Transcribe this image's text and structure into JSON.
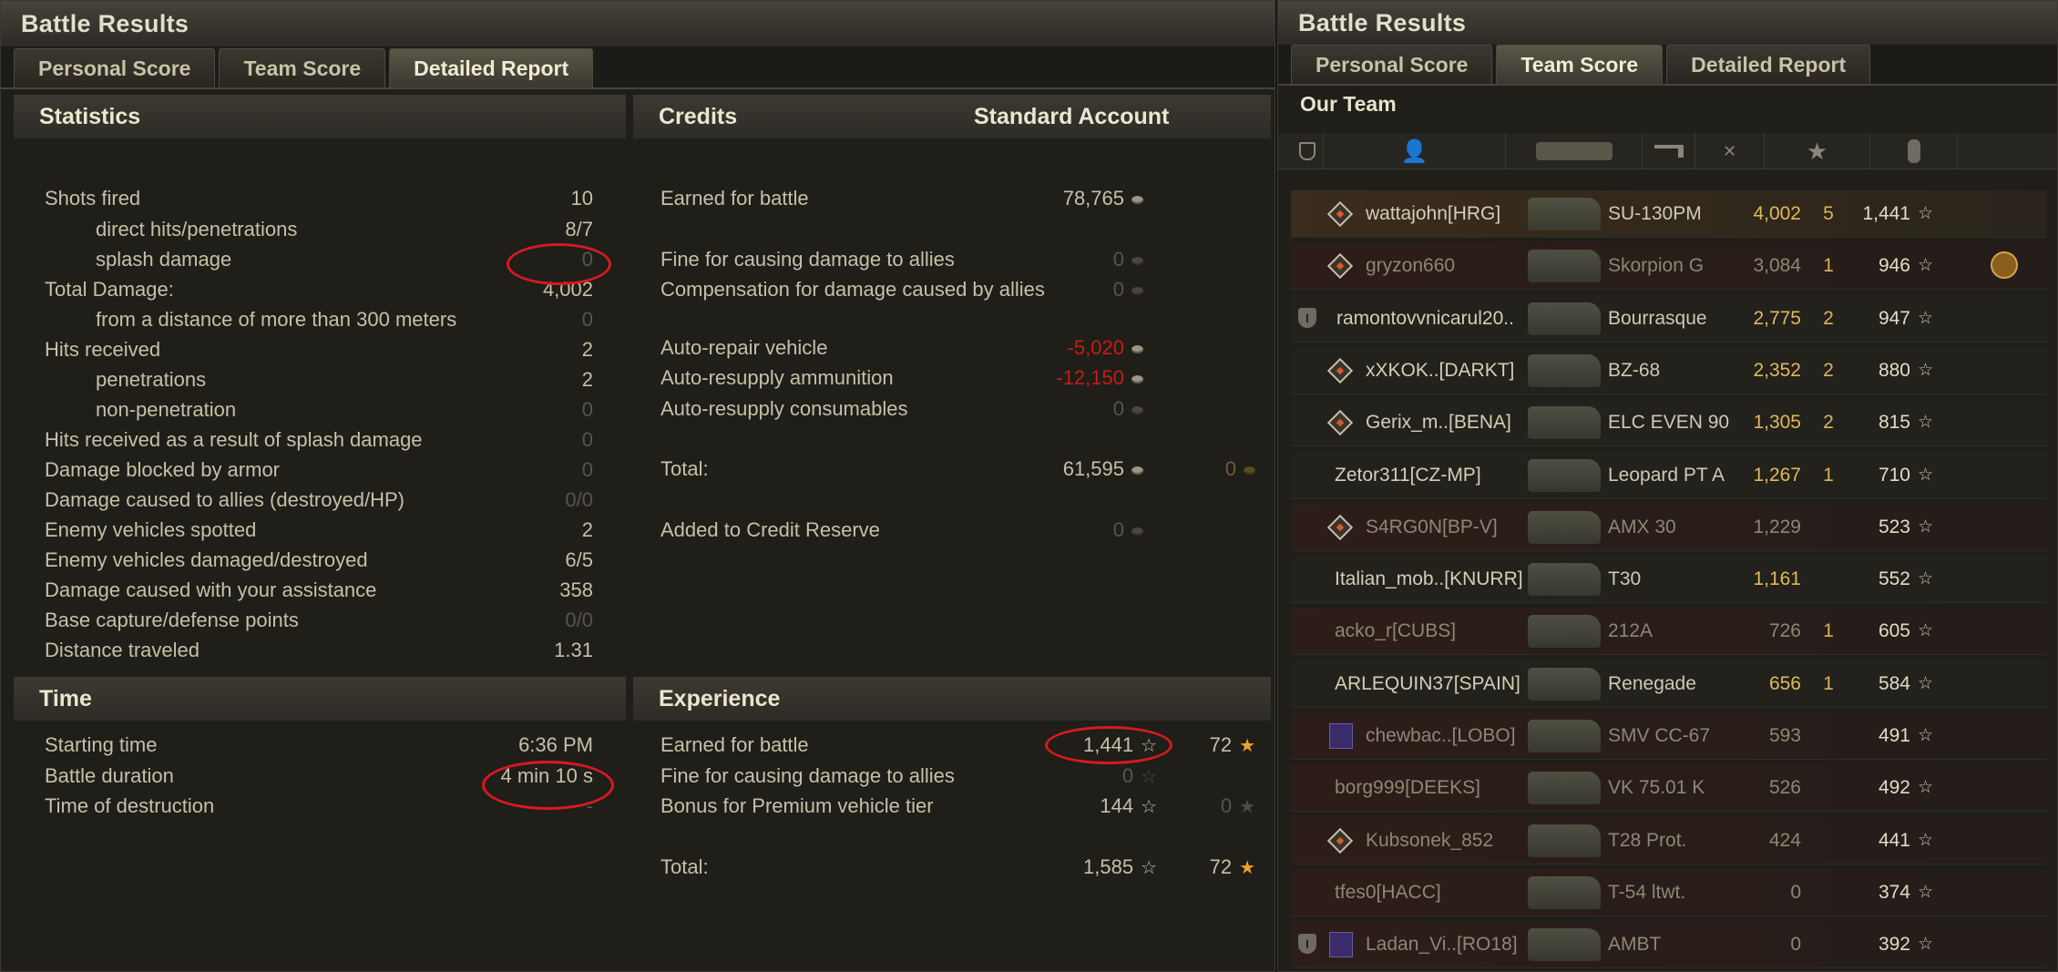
{
  "left_window": {
    "title": "Battle Results",
    "tabs": [
      "Personal Score",
      "Team Score",
      "Detailed Report"
    ],
    "active_tab": 2,
    "statistics": {
      "header": "Statistics",
      "rows": [
        {
          "label": "Shots fired",
          "value": "10",
          "indent": false,
          "dim": false
        },
        {
          "label": "direct hits/penetrations",
          "value": "8/7",
          "indent": true,
          "dim": false
        },
        {
          "label": "splash damage",
          "value": "0",
          "indent": true,
          "dim": true
        },
        {
          "label": "Total Damage:",
          "value": "4,002",
          "indent": false,
          "dim": false
        },
        {
          "label": "from a distance of more than 300 meters",
          "value": "0",
          "indent": true,
          "dim": true
        },
        {
          "label": "Hits received",
          "value": "2",
          "indent": false,
          "dim": false
        },
        {
          "label": "penetrations",
          "value": "2",
          "indent": true,
          "dim": false
        },
        {
          "label": "non-penetration",
          "value": "0",
          "indent": true,
          "dim": true
        },
        {
          "label": "Hits received as a result of splash damage",
          "value": "0",
          "indent": false,
          "dim": true
        },
        {
          "label": "Damage blocked by armor",
          "value": "0",
          "indent": false,
          "dim": true
        },
        {
          "label": "Damage caused to allies (destroyed/HP)",
          "value": "0/0",
          "indent": false,
          "dim": true
        },
        {
          "label": "Enemy vehicles spotted",
          "value": "2",
          "indent": false,
          "dim": false
        },
        {
          "label": "Enemy vehicles damaged/destroyed",
          "value": "6/5",
          "indent": false,
          "dim": false
        },
        {
          "label": "Damage caused with your assistance",
          "value": "358",
          "indent": false,
          "dim": false
        },
        {
          "label": "Base capture/defense points",
          "value": "0/0",
          "indent": false,
          "dim": true
        },
        {
          "label": "Distance traveled",
          "value": "1.31",
          "indent": false,
          "dim": false
        }
      ]
    },
    "credits": {
      "header": "Credits",
      "account_header": "Standard Account",
      "rows": [
        {
          "label": "Earned for battle",
          "value": "78,765",
          "style": "normal",
          "extra": ""
        },
        {
          "label": "Fine for causing damage to allies",
          "value": "0",
          "style": "dim",
          "extra": ""
        },
        {
          "label": "Compensation for damage caused by allies",
          "value": "0",
          "style": "dim",
          "extra": ""
        },
        {
          "label": "Auto-repair vehicle",
          "value": "-5,020",
          "style": "red",
          "extra": ""
        },
        {
          "label": "Auto-resupply ammunition",
          "value": "-12,150",
          "style": "red",
          "extra": ""
        },
        {
          "label": "Auto-resupply consumables",
          "value": "0",
          "style": "dim",
          "extra": ""
        },
        {
          "label": "Total:",
          "value": "61,595",
          "style": "normal",
          "extra": "0"
        },
        {
          "label": "Added to Credit Reserve",
          "value": "0",
          "style": "dim",
          "extra": ""
        }
      ]
    },
    "time": {
      "header": "Time",
      "rows": [
        {
          "label": "Starting time",
          "value": "6:36 PM"
        },
        {
          "label": "Battle duration",
          "value": "4 min 10 s"
        },
        {
          "label": "Time of destruction",
          "value": "-"
        }
      ]
    },
    "experience": {
      "header": "Experience",
      "rows": [
        {
          "label": "Earned for battle",
          "value": "1,441",
          "style": "normal",
          "extra": "72"
        },
        {
          "label": "Fine for causing damage to allies",
          "value": "0",
          "style": "dim",
          "extra": ""
        },
        {
          "label": "Bonus for Premium vehicle tier",
          "value": "144",
          "style": "normal",
          "extra": "0"
        },
        {
          "label": "Total:",
          "value": "1,585",
          "style": "normal",
          "extra": "72"
        }
      ]
    }
  },
  "right_window": {
    "title": "Battle Results",
    "tabs": [
      "Personal Score",
      "Team Score",
      "Detailed Report"
    ],
    "active_tab": 1,
    "team_label": "Our Team",
    "columns_icons": [
      "squad-icon",
      "player-icon",
      "tank-icon",
      "damage-icon",
      "kills-icon",
      "xp-star-icon",
      "medal-icon"
    ],
    "players": [
      {
        "name": "wattajohn[HRG]",
        "vehicle": "SU-130PM",
        "damage": "4,002",
        "kills": "5",
        "xp": "1,441",
        "badge": true,
        "platoon": false,
        "clan": false,
        "medal": false,
        "self": true,
        "alive": true
      },
      {
        "name": "gryzon660",
        "vehicle": "Skorpion G",
        "damage": "3,084",
        "kills": "1",
        "xp": "946",
        "badge": true,
        "platoon": false,
        "clan": false,
        "medal": true,
        "self": false,
        "alive": false
      },
      {
        "name": "ramontovvnicarul20..",
        "vehicle": "Bourrasque",
        "damage": "2,775",
        "kills": "2",
        "xp": "947",
        "badge": false,
        "platoon": true,
        "clan": false,
        "medal": false,
        "self": false,
        "alive": true
      },
      {
        "name": "xXKOK..[DARKT]",
        "vehicle": "BZ-68",
        "damage": "2,352",
        "kills": "2",
        "xp": "880",
        "badge": true,
        "platoon": false,
        "clan": false,
        "medal": false,
        "self": false,
        "alive": true
      },
      {
        "name": "Gerix_m..[BENA]",
        "vehicle": "ELC EVEN 90",
        "damage": "1,305",
        "kills": "2",
        "xp": "815",
        "badge": true,
        "platoon": false,
        "clan": false,
        "medal": false,
        "self": false,
        "alive": true
      },
      {
        "name": "Zetor311[CZ-MP]",
        "vehicle": "Leopard PT A",
        "damage": "1,267",
        "kills": "1",
        "xp": "710",
        "badge": false,
        "platoon": false,
        "clan": false,
        "medal": false,
        "self": false,
        "alive": true
      },
      {
        "name": "S4RG0N[BP-V]",
        "vehicle": "AMX 30",
        "damage": "1,229",
        "kills": "",
        "xp": "523",
        "badge": true,
        "platoon": false,
        "clan": false,
        "medal": false,
        "self": false,
        "alive": false
      },
      {
        "name": "Italian_mob..[KNURR]",
        "vehicle": "T30",
        "damage": "1,161",
        "kills": "",
        "xp": "552",
        "badge": false,
        "platoon": false,
        "clan": false,
        "medal": false,
        "self": false,
        "alive": true
      },
      {
        "name": "acko_r[CUBS]",
        "vehicle": "212A",
        "damage": "726",
        "kills": "1",
        "xp": "605",
        "badge": false,
        "platoon": false,
        "clan": false,
        "medal": false,
        "self": false,
        "alive": false
      },
      {
        "name": "ARLEQUIN37[SPAIN]",
        "vehicle": "Renegade",
        "damage": "656",
        "kills": "1",
        "xp": "584",
        "badge": false,
        "platoon": false,
        "clan": false,
        "medal": false,
        "self": false,
        "alive": true
      },
      {
        "name": "chewbac..[LOBO]",
        "vehicle": "SMV CC-67",
        "damage": "593",
        "kills": "",
        "xp": "491",
        "badge": false,
        "platoon": false,
        "clan": true,
        "medal": false,
        "self": false,
        "alive": false
      },
      {
        "name": "borg999[DEEKS]",
        "vehicle": "VK 75.01 K",
        "damage": "526",
        "kills": "",
        "xp": "492",
        "badge": false,
        "platoon": false,
        "clan": false,
        "medal": false,
        "self": false,
        "alive": false
      },
      {
        "name": "Kubsonek_852",
        "vehicle": "T28 Prot.",
        "damage": "424",
        "kills": "",
        "xp": "441",
        "badge": true,
        "platoon": false,
        "clan": false,
        "medal": false,
        "self": false,
        "alive": false
      },
      {
        "name": "tfes0[HACC]",
        "vehicle": "T-54 ltwt.",
        "damage": "0",
        "kills": "",
        "xp": "374",
        "badge": false,
        "platoon": false,
        "clan": false,
        "medal": false,
        "self": false,
        "alive": false
      },
      {
        "name": "Ladan_Vi..[RO18]",
        "vehicle": "AMBT",
        "damage": "0",
        "kills": "",
        "xp": "392",
        "badge": false,
        "platoon": true,
        "clan": true,
        "medal": false,
        "self": false,
        "alive": false
      }
    ]
  },
  "colors": {
    "highlight_oval": "#d71920",
    "negative": "#c51d14",
    "dead_row": "#2c1c18",
    "self_row": "#3a2a1c"
  }
}
